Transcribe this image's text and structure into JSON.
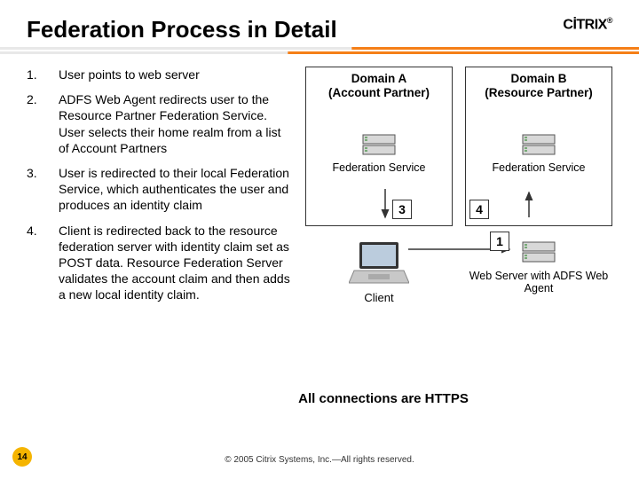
{
  "page_number": "14",
  "title": "Federation Process in Detail",
  "logo": "CİTRIX",
  "logo_reg": "®",
  "steps": [
    {
      "num": "1.",
      "text": "User points to web server"
    },
    {
      "num": "2.",
      "text": "ADFS Web Agent redirects user to the Resource Partner Federation Service. User selects their home realm from a list of Account Partners"
    },
    {
      "num": "3.",
      "text": "User is redirected to their local Federation Service, which authenticates the user and produces an identity claim"
    },
    {
      "num": "4.",
      "text": "Client is redirected back to the resource federation server with identity claim set as POST data. Resource Federation Server validates the account claim and then adds a new local identity claim."
    }
  ],
  "domain_a": {
    "title": "Domain A",
    "subtitle": "(Account Partner)",
    "service": "Federation Service"
  },
  "domain_b": {
    "title": "Domain B",
    "subtitle": "(Resource Partner)",
    "service": "Federation Service"
  },
  "client_label": "Client",
  "webserver_label": "Web Server with ADFS Web Agent",
  "box_labels": {
    "n1": "1",
    "n3": "3",
    "n4": "4"
  },
  "footnote": "All connections are HTTPS",
  "copyright": "© 2005 Citrix Systems, Inc.—All rights reserved."
}
